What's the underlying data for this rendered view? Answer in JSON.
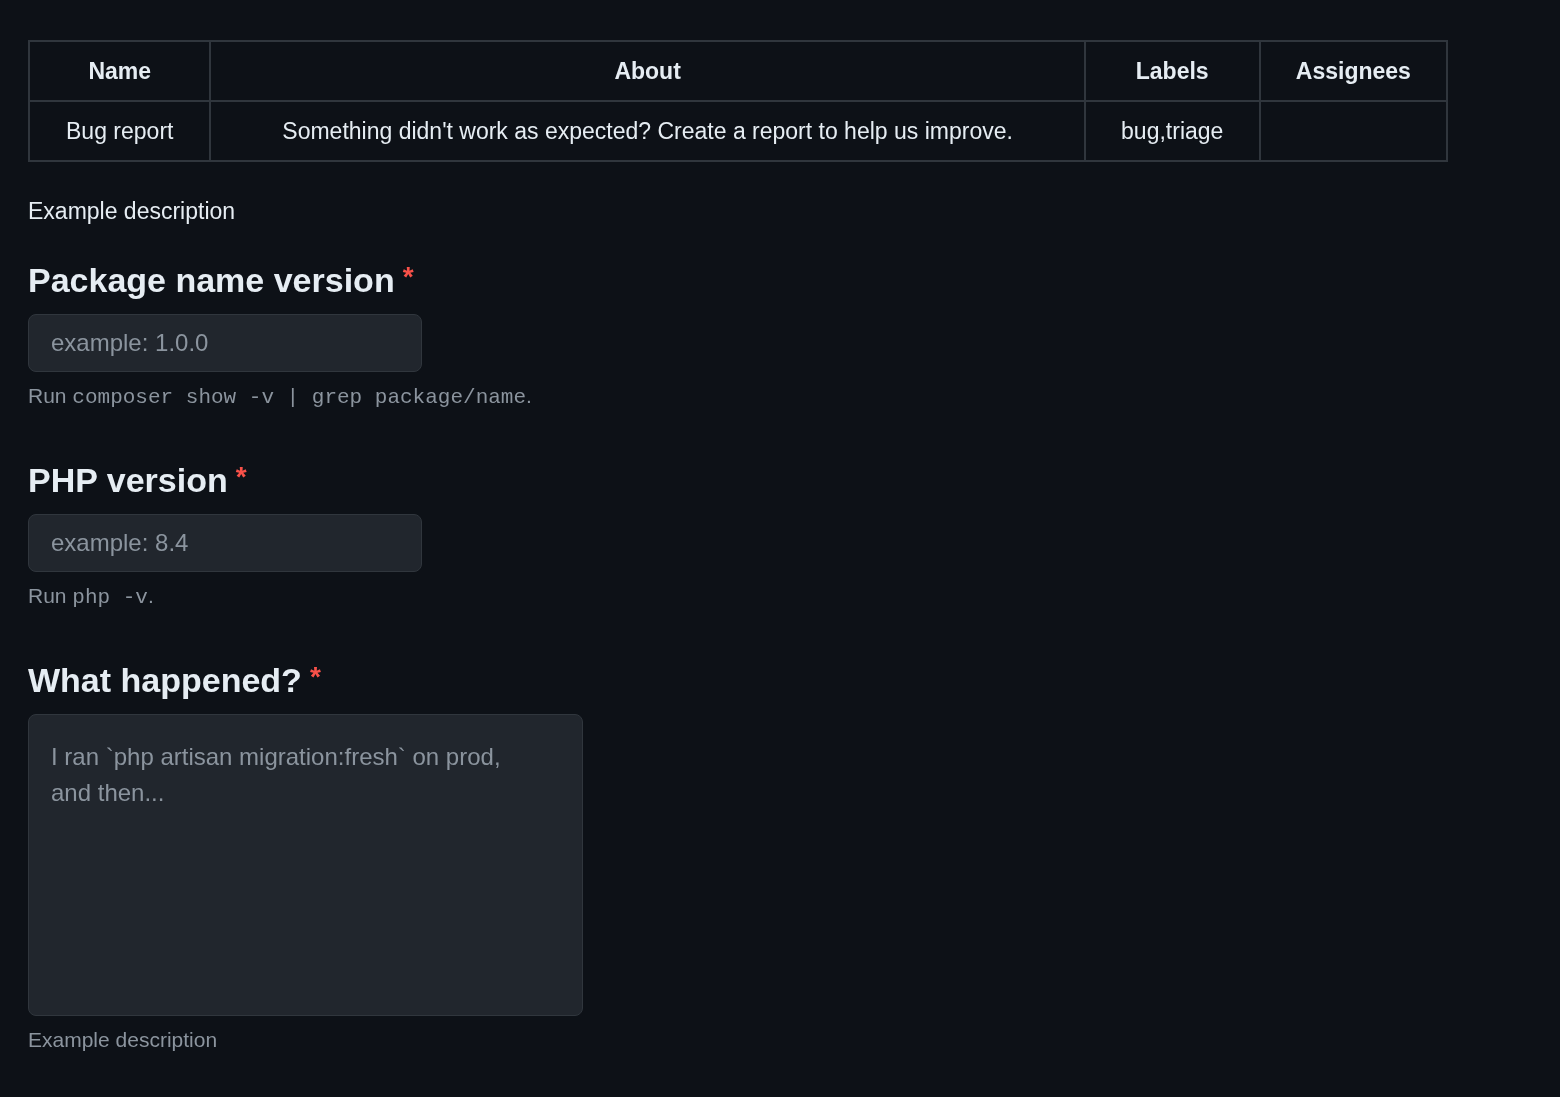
{
  "table": {
    "columns": [
      "Name",
      "About",
      "Labels",
      "Assignees"
    ],
    "rows": [
      [
        "Bug report",
        "Something didn't work as expected? Create a report to help us improve.",
        "bug,triage",
        ""
      ]
    ]
  },
  "intro": "Example description",
  "fields": [
    {
      "kind": "input",
      "label": "Package name version",
      "required_mark": "*",
      "placeholder": "example: 1.0.0",
      "hint": [
        {
          "text": "Run ",
          "code": false
        },
        {
          "text": "composer show -v | grep package/name",
          "code": true
        },
        {
          "text": ".",
          "code": false
        }
      ]
    },
    {
      "kind": "input",
      "label": "PHP version",
      "required_mark": "*",
      "placeholder": "example: 8.4",
      "hint": [
        {
          "text": "Run ",
          "code": false
        },
        {
          "text": "php -v",
          "code": true
        },
        {
          "text": ".",
          "code": false
        }
      ]
    },
    {
      "kind": "textarea",
      "label": "What happened?",
      "required_mark": "*",
      "placeholder": "I ran `php artisan migration:fresh` on prod, and then...",
      "hint": [
        {
          "text": "Example description",
          "code": false
        }
      ]
    }
  ]
}
